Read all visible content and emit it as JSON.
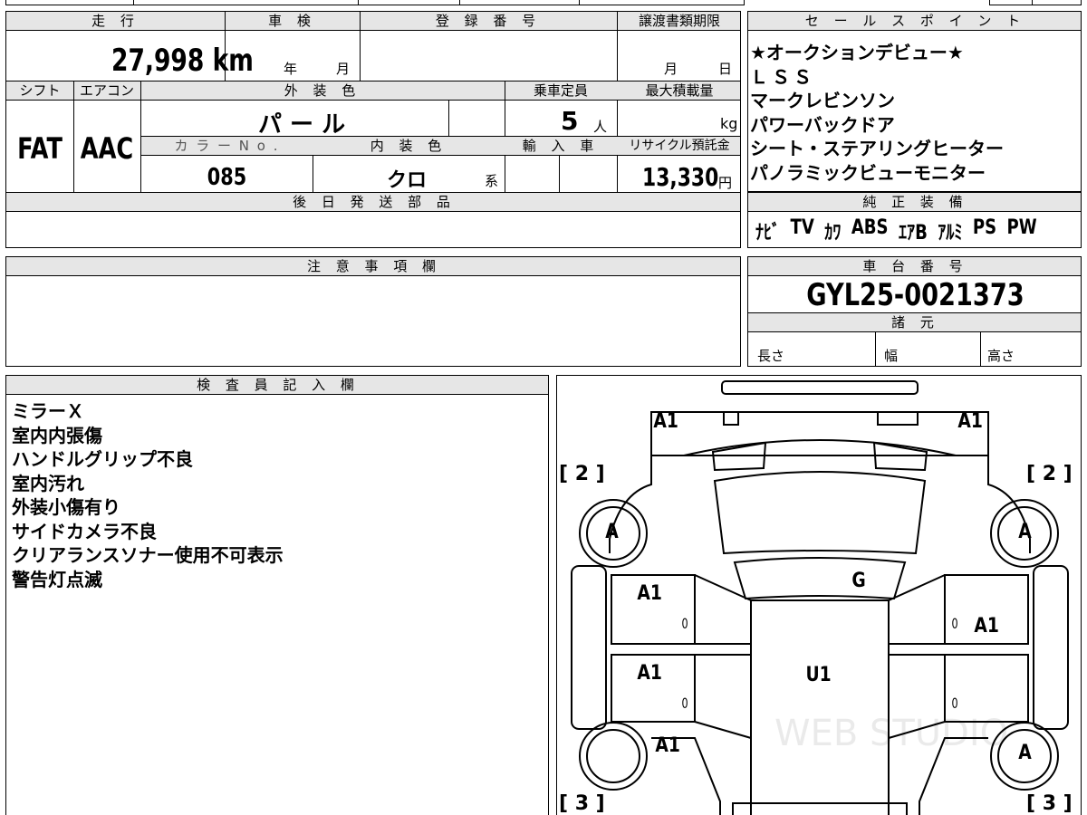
{
  "top_table": {
    "labels": {
      "mileage": "走 行",
      "inspection": "車 検",
      "registration": "登 録 番 号",
      "transfer_deadline": "譲渡書類期限",
      "shift": "シフト",
      "aircon": "エアコン",
      "exterior_color": "外 装 色",
      "capacity": "乗車定員",
      "max_load": "最大積載量",
      "color_no": "カ ラ ー N o .",
      "interior_color": "内 装 色",
      "import": "輸 入 車",
      "recycle": "リサイクル預託金",
      "later_parts": "後 日 発 送 部 品"
    },
    "mileage_value": "27,998 km",
    "inspection_year": "年",
    "inspection_month": "月",
    "deadline_month": "月",
    "deadline_day": "日",
    "shift_value": "FAT",
    "aircon_value": "AAC",
    "exterior_color_value": "パ ー ル",
    "capacity_value": "5",
    "capacity_unit": "人",
    "max_load_unit": "kg",
    "color_no_value": "085",
    "interior_color_value": "クロ",
    "interior_suffix": "系",
    "recycle_value": "13,330",
    "recycle_unit": "円"
  },
  "sales_points": {
    "header": "セ ー ル ス ポ イ ン ト",
    "items": [
      "★オークションデビュー★",
      "ＬＳＳ",
      "マークレビンソン",
      "パワーバックドア",
      "シート・ステアリングヒーター",
      "パノラミックビューモニター"
    ]
  },
  "genuine_equipment": {
    "header": "純 正 装 備",
    "items": [
      "ﾅﾋﾞ",
      "TV",
      "ｶﾜ",
      "ABS",
      "ｴｱB",
      "ｱﾙﾐ",
      "PS",
      "PW"
    ]
  },
  "notes": {
    "header": "注 意 事 項 欄"
  },
  "chassis": {
    "header": "車 台 番 号",
    "value": "GYL25-0021373",
    "specs_header": "諸 元",
    "length": "長さ",
    "width": "幅",
    "height": "高さ"
  },
  "inspector": {
    "header": "検 査 員 記 入 欄",
    "lines": [
      "ミラーＸ",
      "室内内張傷",
      "ハンドルグリップ不良",
      "室内汚れ",
      "外装小傷有り",
      "サイドカメラ不良",
      "クリアランスソナー使用不可表示",
      "警告灯点滅"
    ]
  },
  "diagram": {
    "marks": {
      "front_left": "A1",
      "front_right": "A1",
      "wheel_fl": "A",
      "wheel_fr": "A",
      "wheel_rr": "A",
      "door_fl": "A1",
      "door_fr": "A1",
      "door_rl": "A1",
      "rear_left": "A1",
      "windshield": "G",
      "roof": "U1",
      "zero1": "0",
      "zero2": "0",
      "zero3": "0",
      "zero4": "0"
    },
    "bracket_2": "[ 2 ]",
    "bracket_3": "[ 3 ]",
    "watermark": "WEB STUDIO"
  }
}
